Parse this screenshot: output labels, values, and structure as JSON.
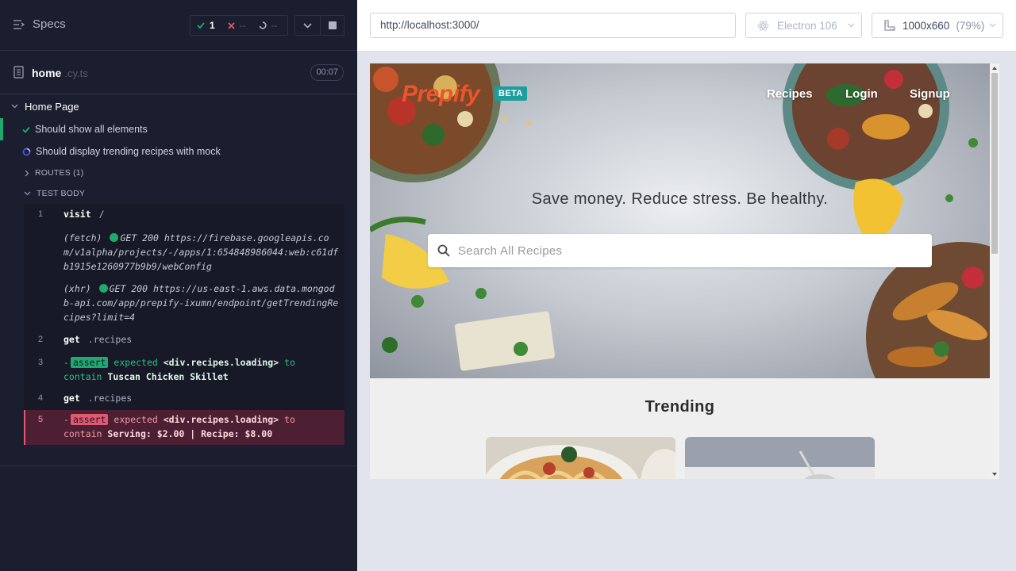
{
  "reporter": {
    "specs_label": "Specs",
    "stats": {
      "passed": "1",
      "failed": "--",
      "pending": "--"
    },
    "file": {
      "name": "home",
      "ext": ".cy.ts",
      "duration": "00:07"
    },
    "suite": "Home Page",
    "tests": [
      {
        "title": "Should show all elements",
        "state": "passed"
      },
      {
        "title": "Should display trending recipes with mock",
        "state": "running"
      }
    ],
    "routes_label": "ROUTES (1)",
    "test_body_label": "TEST BODY",
    "commands": {
      "c1": {
        "num": "1",
        "name": "visit",
        "arg": "/"
      },
      "fetch": {
        "type": "(fetch)",
        "method": "GET 200",
        "url": "https://firebase.googleapis.com/v1alpha/projects/-/apps/1:654848986044:web:c61dfb1915e1260977b9b9/webConfig"
      },
      "xhr": {
        "type": "(xhr)",
        "method": "GET 200",
        "url": "https://us-east-1.aws.data.mongodb-api.com/app/prepify-ixumn/endpoint/getTrendingRecipes?limit=4"
      },
      "c2": {
        "num": "2",
        "name": "get",
        "arg": ".recipes"
      },
      "c3": {
        "num": "3",
        "dash": "-",
        "tag": "assert",
        "expected": "expected",
        "subject": "<div.recipes.loading>",
        "to": "to",
        "contain": "contain",
        "value": "Tuscan Chicken Skillet"
      },
      "c4": {
        "num": "4",
        "name": "get",
        "arg": ".recipes"
      },
      "c5": {
        "num": "5",
        "dash": "-",
        "tag": "assert",
        "expected": "expected",
        "subject": "<div.recipes.loading>",
        "to": "to",
        "contain": "contain",
        "value": "Serving: $2.00 | Recipe: $8.00"
      }
    }
  },
  "runner": {
    "url": "http://localhost:3000/",
    "browser": "Electron 106",
    "viewport": "1000x660",
    "zoom": "(79%)"
  },
  "app": {
    "logo": "Prepify",
    "beta": "BETA",
    "nav": [
      "Recipes",
      "Login",
      "Signup"
    ],
    "tagline": "Save money. Reduce stress. Be healthy.",
    "search_placeholder": "Search All Recipes",
    "trending": "Trending"
  },
  "colors": {
    "reporter_bg": "#1b1e2e",
    "pass": "#1fa971",
    "fail": "#e45770",
    "brand": "#f0532b",
    "beta_badge": "#1d9e9e"
  }
}
